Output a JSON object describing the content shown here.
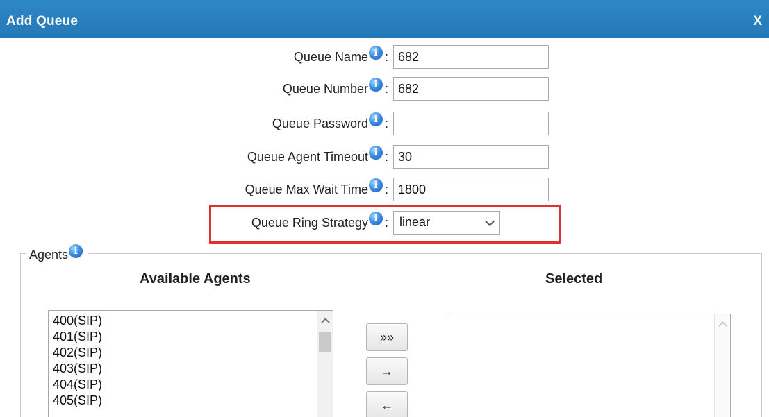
{
  "window": {
    "title": "Add Queue",
    "close_label": "X"
  },
  "form": {
    "queue_name": {
      "label": "Queue Name",
      "value": "682"
    },
    "queue_number": {
      "label": "Queue Number",
      "value": "682"
    },
    "queue_password": {
      "label": "Queue Password",
      "value": ""
    },
    "queue_agent_timeout": {
      "label": "Queue Agent Timeout",
      "value": "30"
    },
    "queue_max_wait_time": {
      "label": "Queue Max Wait Time",
      "value": "1800"
    },
    "queue_ring_strategy": {
      "label": "Queue Ring Strategy",
      "selected": "linear"
    },
    "colon": ":"
  },
  "info_icon_glyph": "i",
  "agents": {
    "legend": "Agents",
    "available_heading": "Available Agents",
    "selected_heading": "Selected",
    "available_items": [
      "400(SIP)",
      "401(SIP)",
      "402(SIP)",
      "403(SIP)",
      "404(SIP)",
      "405(SIP)"
    ],
    "selected_items": [],
    "buttons": {
      "add_all": "»»",
      "add": "→",
      "remove": "←"
    }
  },
  "colors": {
    "titlebar": "#2a80bf",
    "highlight": "#e03030",
    "info_icon": "#3f8fe0"
  }
}
